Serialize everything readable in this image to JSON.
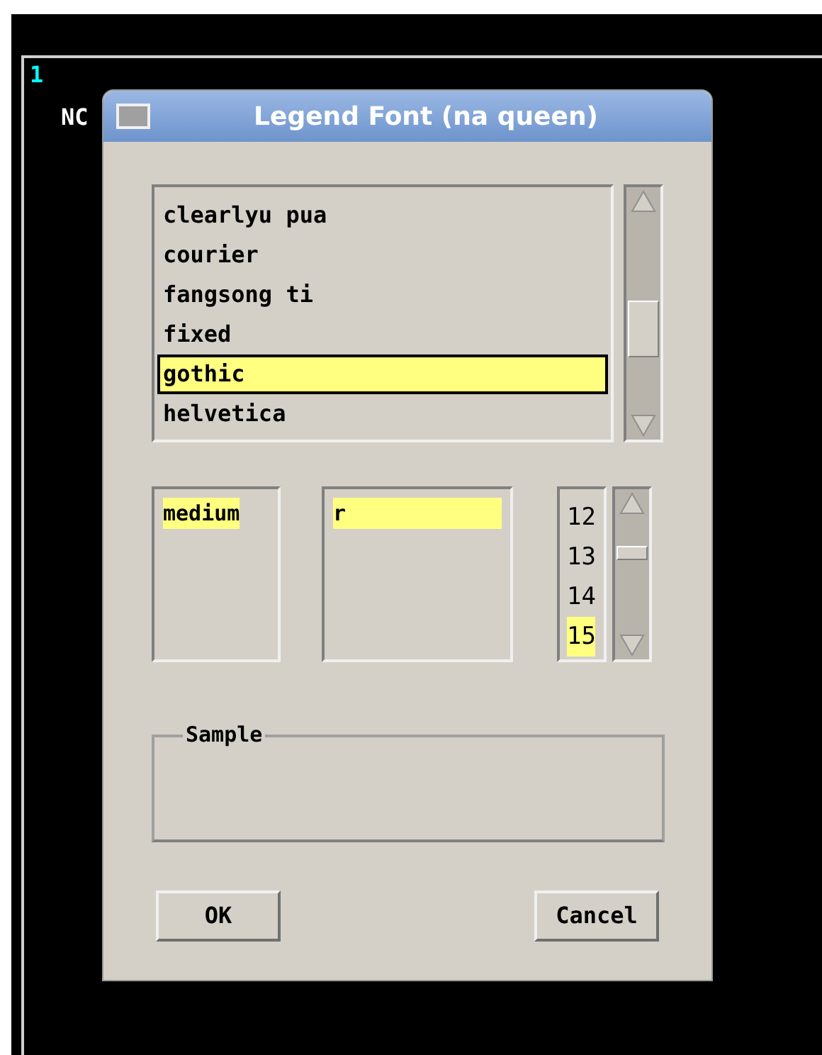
{
  "background": {
    "line_number": "1",
    "text": "NC"
  },
  "dialog": {
    "title": "Legend Font (na queen)",
    "families": [
      {
        "label": "clearlyu pua",
        "selected": false
      },
      {
        "label": "courier",
        "selected": false
      },
      {
        "label": "fangsong ti",
        "selected": false
      },
      {
        "label": "fixed",
        "selected": false
      },
      {
        "label": "gothic",
        "selected": true
      },
      {
        "label": "helvetica",
        "selected": false
      }
    ],
    "weights": [
      {
        "label": "medium",
        "selected": true
      }
    ],
    "slants": [
      {
        "label": "r",
        "selected": true
      }
    ],
    "sizes": [
      {
        "label": "12",
        "selected": false
      },
      {
        "label": "13",
        "selected": false
      },
      {
        "label": "14",
        "selected": false
      },
      {
        "label": "15",
        "selected": true
      }
    ],
    "sample": {
      "label": "Sample"
    },
    "buttons": [
      "OK",
      "Cancel"
    ]
  }
}
